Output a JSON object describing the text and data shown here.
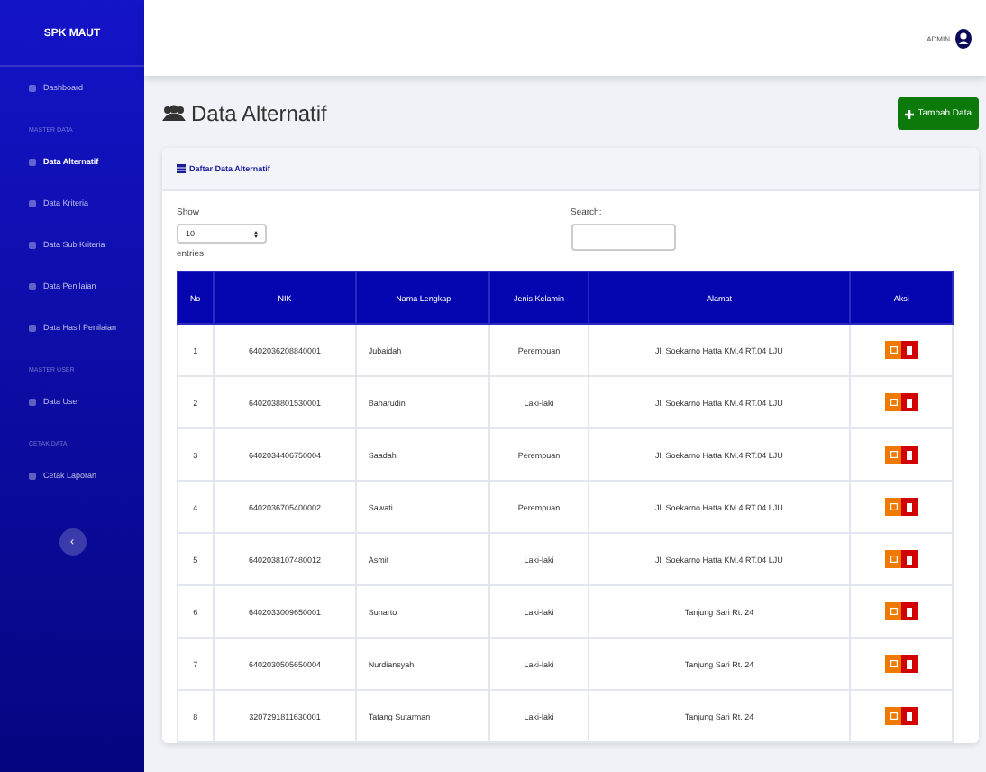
{
  "sidebar": {
    "brand": "SPK MAUT",
    "sections": [
      {
        "items": [
          {
            "label": "Dashboard",
            "selected": false
          }
        ]
      },
      {
        "heading": "MASTER DATA",
        "items": [
          {
            "label": "Data Alternatif",
            "selected": true
          },
          {
            "label": "Data Kriteria",
            "selected": false
          },
          {
            "label": "Data Sub Kriteria",
            "selected": false
          },
          {
            "label": "Data Penilaian",
            "selected": false
          },
          {
            "label": "Data Hasil Penilaian",
            "selected": false
          }
        ]
      },
      {
        "heading": "MASTER USER",
        "items": [
          {
            "label": "Data User",
            "selected": false
          }
        ]
      },
      {
        "heading": "CETAK DATA",
        "items": [
          {
            "label": "Cetak Laporan",
            "selected": false
          }
        ]
      }
    ],
    "toggle": "‹"
  },
  "topbar": {
    "user": "ADMIN"
  },
  "page": {
    "title": "Data Alternatif",
    "add_button": "Tambah Data"
  },
  "card": {
    "title": "Daftar Data Alternatif",
    "show_label": "Show",
    "entries_value": "10",
    "entries_label": "entries",
    "search_label": "Search:",
    "columns": [
      "No",
      "NIK",
      "Nama Lengkap",
      "Jenis Kelamin",
      "Alamat",
      "Aksi"
    ],
    "rows": [
      [
        "1",
        "6402036208840001",
        "Jubaidah",
        "Perempuan",
        "Jl. Soekarno Hatta KM.4 RT.04 LJU"
      ],
      [
        "2",
        "6402038801530001",
        "Baharudin",
        "Laki-laki",
        "Jl. Soekarno Hatta KM.4 RT.04 LJU"
      ],
      [
        "3",
        "6402034406750004",
        "Saadah",
        "Perempuan",
        "Jl. Soekarno Hatta KM.4 RT.04 LJU"
      ],
      [
        "4",
        "6402036705400002",
        "Sawati",
        "Perempuan",
        "Jl. Soekarno Hatta KM.4 RT.04 LJU"
      ],
      [
        "5",
        "6402038107480012",
        "Asmit",
        "Laki-laki",
        "Jl. Soekarno Hatta KM.4 RT.04 LJU"
      ],
      [
        "6",
        "6402033009650001",
        "Sunarto",
        "Laki-laki",
        "Tanjung Sari Rt. 24"
      ],
      [
        "7",
        "6402030505650004",
        "Nurdiansyah",
        "Laki-laki",
        "Tanjung Sari Rt. 24"
      ],
      [
        "8",
        "3207291811630001",
        "Tatang Sutarman",
        "Laki-laki",
        "Tanjung Sari Rt. 24"
      ]
    ]
  }
}
